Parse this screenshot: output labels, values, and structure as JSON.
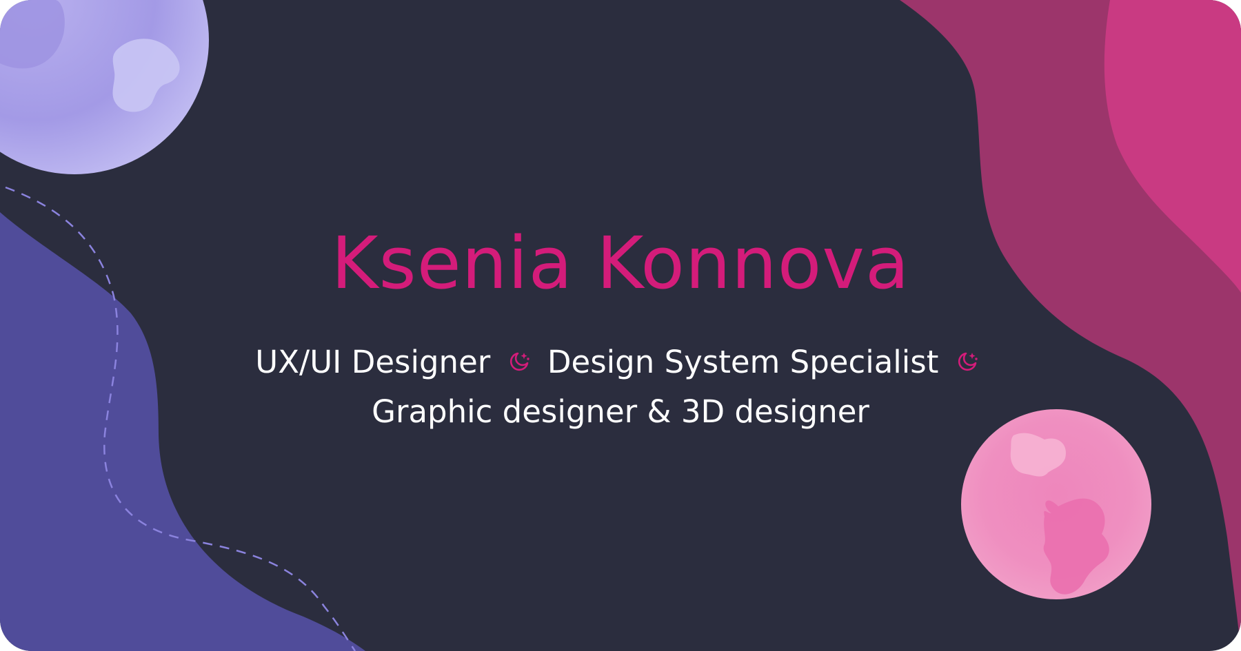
{
  "profile": {
    "name": "Ksenia Konnova",
    "role_1": "UX/UI Designer",
    "role_2": "Design System Specialist",
    "role_3": "Graphic designer & 3D designer",
    "separator_icon": "moon-stars-icon"
  },
  "colors": {
    "background": "#2b2d3e",
    "accent": "#d41c7a",
    "text": "#ffffff",
    "purple_wave": "#504c9a",
    "magenta_wave": "#9c356b",
    "pink_wave": "#c93a82",
    "lavender_planet": "#a99de6",
    "pink_planet": "#f2a1c9"
  }
}
